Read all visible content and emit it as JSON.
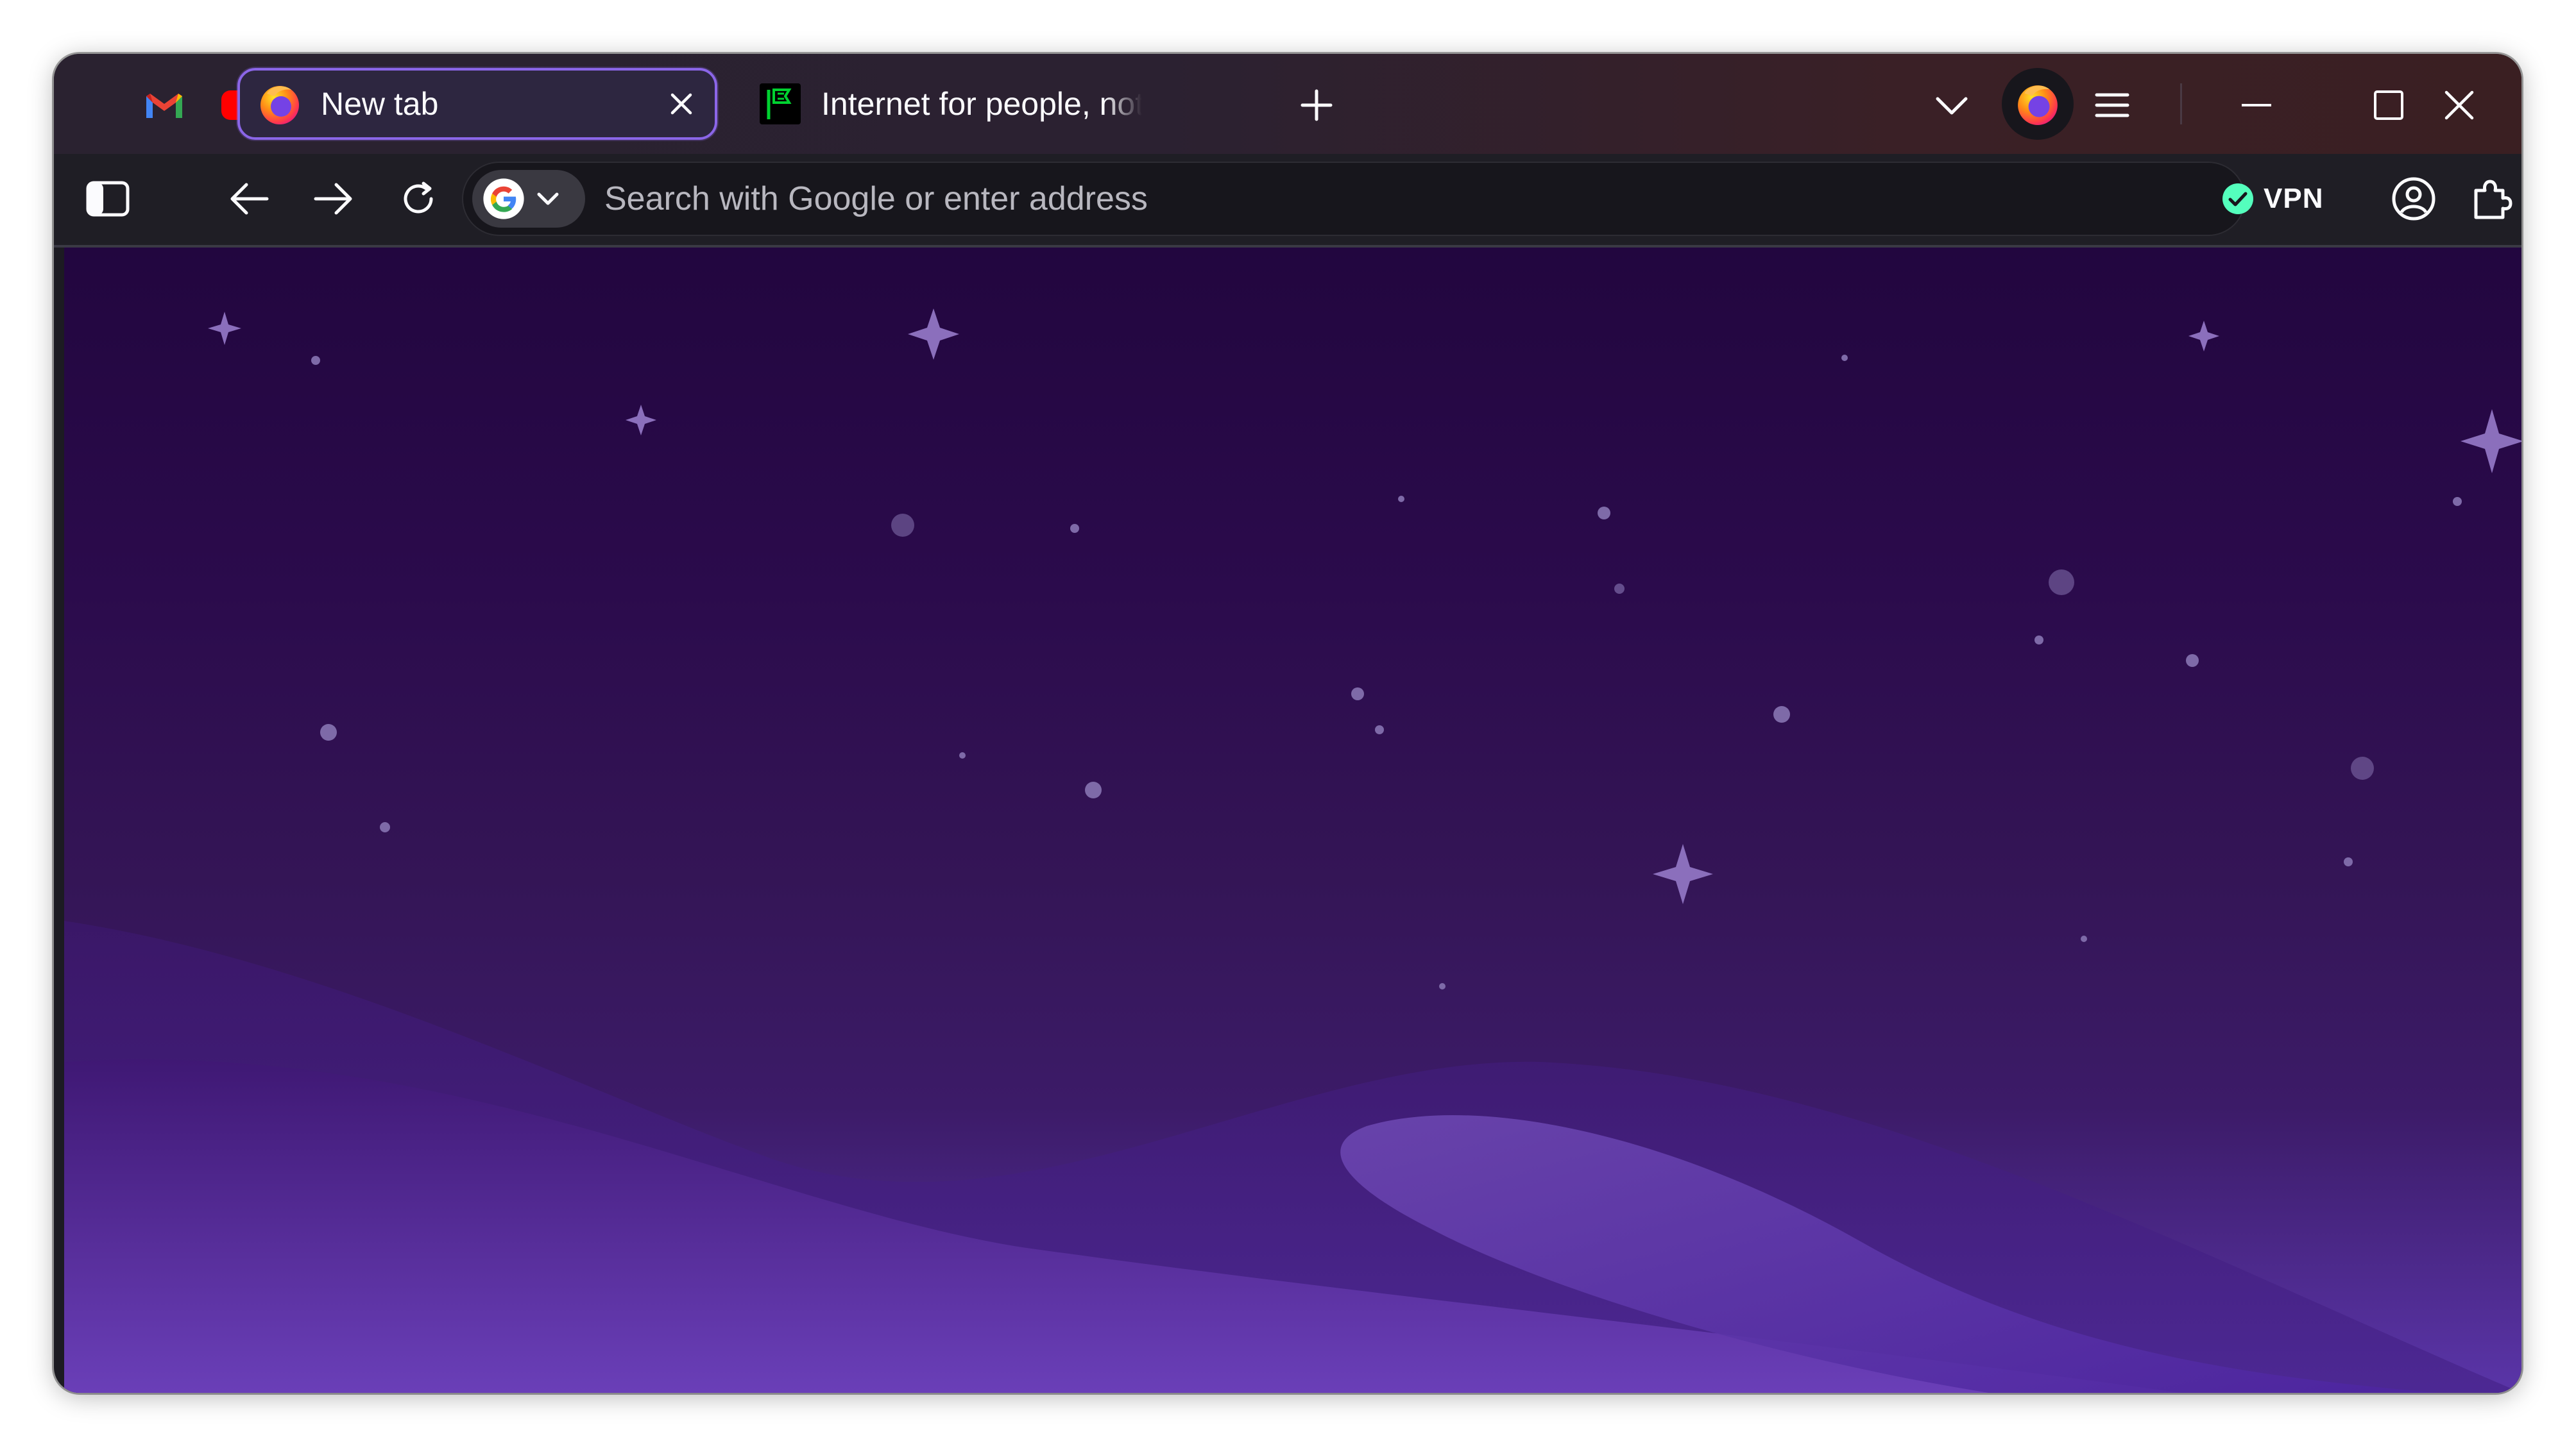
{
  "tabs": {
    "pinned": [
      {
        "name": "Gmail",
        "icon": "gmail-icon"
      },
      {
        "name": "YouTube",
        "icon": "youtube-icon"
      }
    ],
    "items": [
      {
        "title": "New tab",
        "active": true,
        "icon": "firefox-icon"
      },
      {
        "title": "Internet for people, not profit",
        "active": false,
        "icon": "mozilla-flag-icon"
      }
    ],
    "new_tab_icon": "plus-icon",
    "list_all_tabs_icon": "chevron-down-icon"
  },
  "window_controls": [
    "minimize-icon",
    "maximize-icon",
    "close-icon"
  ],
  "navbar": {
    "search_placeholder": "Search with Google or enter address",
    "search_engine": "Google",
    "vpn_label": "VPN",
    "vpn_status_color": "#54ffbd"
  },
  "colors": {
    "accent": "#8b66e8",
    "tabstrip": "#2b2131",
    "background_top": "#22063f",
    "background_bottom": "#5a35a8"
  }
}
